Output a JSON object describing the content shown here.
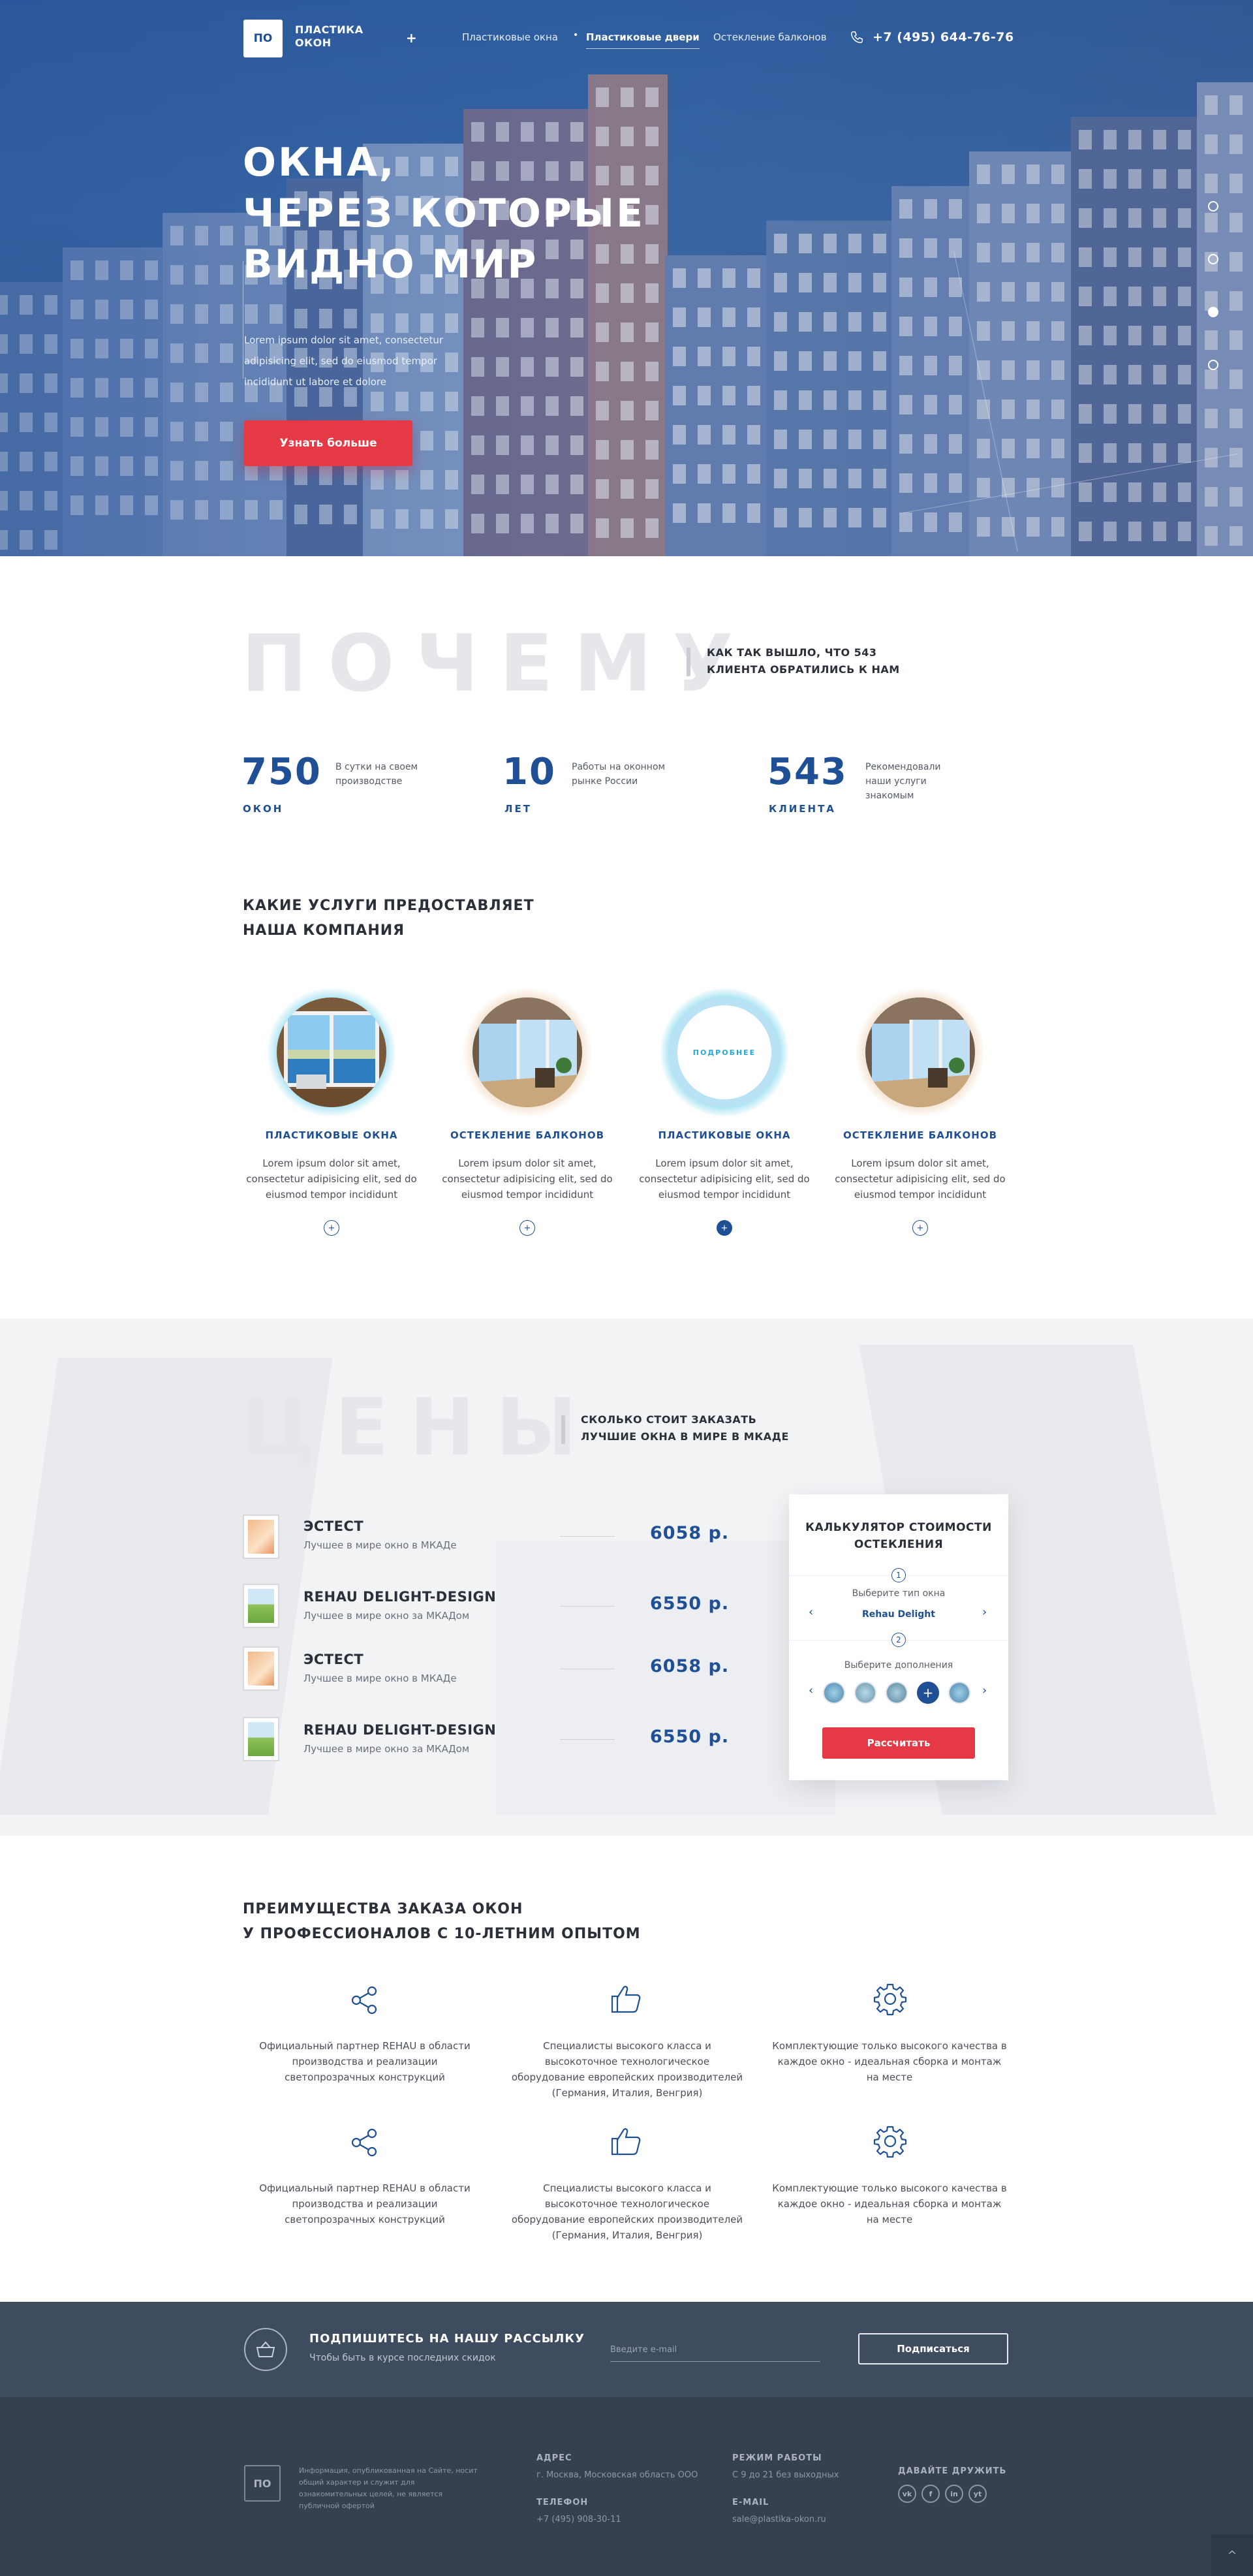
{
  "header": {
    "logo_mark": "ПО",
    "logo_text": "ПЛАСТИКА ОКОН",
    "nav": [
      "Пластиковые окна",
      "Пластиковые двери",
      "Остекление балконов"
    ],
    "active_nav": "Пластиковые двери",
    "phone": "+7 (495) 644-76-76"
  },
  "hero": {
    "title_lines": [
      "ОКНА,",
      "ЧЕРЕЗ КОТОРЫЕ",
      "ВИДНО МИР"
    ],
    "text": "Lorem ipsum dolor sit amet, consectetur adipisicing elit, sed do eiusmod tempor incididunt ut labore et dolore",
    "button": "Узнать больше",
    "slides_count": 4,
    "active_slide": 3
  },
  "why": {
    "big_word": "ПОЧЕМУ",
    "side_text": "КАК ТАК ВЫШЛО, ЧТО 543 КЛИЕНТА ОБРАТИЛИСЬ К НАМ",
    "stats": [
      {
        "num": "750",
        "unit": "ОКОН",
        "desc": "В сутки на своем производстве"
      },
      {
        "num": "10",
        "unit": "ЛЕТ",
        "desc": "Работы на оконном рынке России"
      },
      {
        "num": "543",
        "unit": "КЛИЕНТА",
        "desc": "Рекомендовали наши услуги знакомым"
      }
    ]
  },
  "services": {
    "heading_lines": [
      "КАКИЕ УСЛУГИ ПРЕДОСТАВЛЯЕТ",
      "НАША КОМПАНИЯ"
    ],
    "hover_label": "ПОДРОБНЕЕ",
    "items": [
      {
        "title": "ПЛАСТИКОВЫЕ ОКНА",
        "text": "Lorem ipsum dolor sit amet, consectetur adipisicing elit, sed do eiusmod tempor incididunt"
      },
      {
        "title": "ОСТЕКЛЕНИЕ БАЛКОНОВ",
        "text": "Lorem ipsum dolor sit amet, consectetur adipisicing elit, sed do eiusmod tempor incididunt"
      },
      {
        "title": "ПЛАСТИКОВЫЕ ОКНА",
        "text": "Lorem ipsum dolor sit amet, consectetur adipisicing elit, sed do eiusmod tempor incididunt"
      },
      {
        "title": "ОСТЕКЛЕНИЕ БАЛКОНОВ",
        "text": "Lorem ipsum dolor sit amet, consectetur adipisicing elit, sed do eiusmod tempor incididunt"
      }
    ],
    "more_symbol": "+"
  },
  "prices": {
    "big_word": "ЦЕНЫ",
    "side_text": "СКОЛЬКО СТОИТ ЗАКАЗАТЬ ЛУЧШИЕ ОКНА В МИРЕ В МКАДЕ",
    "items": [
      {
        "name": "ЭСТЕСТ",
        "sub": "Лучшее в мире окно в МКАДе",
        "price": "6058 р."
      },
      {
        "name": "REHAU DELIGHT-DESIGN",
        "sub": "Лучшее в мире окно за МКАДом",
        "price": "6550 р."
      },
      {
        "name": "ЭСТЕСТ",
        "sub": "Лучшее в мире окно в МКАДе",
        "price": "6058 р."
      },
      {
        "name": "REHAU DELIGHT-DESIGN",
        "sub": "Лучшее в мире окно за МКАДом",
        "price": "6550 р."
      }
    ]
  },
  "calculator": {
    "title": "КАЛЬКУЛЯТОР СТОИМОСТИ ОСТЕКЛЕНИЯ",
    "step1": "1",
    "step1_label": "Выберите тип окна",
    "step1_value": "Rehau Delight",
    "step2": "2",
    "step2_label": "Выберите дополнения",
    "prev": "‹",
    "next": "›",
    "plus": "+",
    "button": "Рассчитать"
  },
  "advantages": {
    "heading_lines": [
      "ПРЕИМУЩЕСТВА ЗАКАЗА ОКОН",
      "У ПРОФЕССИОНАЛОВ С 10-ЛЕТНИМ ОПЫТОМ"
    ],
    "items": [
      {
        "icon": "share-icon",
        "text": "Официальный партнер REHAU в области производства и реализации светопрозрачных конструкций"
      },
      {
        "icon": "thumbs-up-icon",
        "text": "Специалисты высокого класса и высокоточное технологическое оборудование европейских производителей (Германия, Италия, Венгрия)"
      },
      {
        "icon": "gear-icon",
        "text": "Комплектующие только высокого качества в каждое окно - идеальная сборка и монтаж на месте"
      },
      {
        "icon": "share-icon",
        "text": "Официальный партнер REHAU в области производства и реализации светопрозрачных конструкций"
      },
      {
        "icon": "thumbs-up-icon",
        "text": "Специалисты высокого класса и высокоточное технологическое оборудование европейских производителей (Германия, Италия, Венгрия)"
      },
      {
        "icon": "gear-icon",
        "text": "Комплектующие только высокого качества в каждое окно - идеальная сборка и монтаж на месте"
      }
    ]
  },
  "subscribe": {
    "title": "ПОДПИШИТЕСЬ НА НАШУ РАССЫЛКУ",
    "text": "Чтобы быть в курсе последних скидок",
    "placeholder": "Введите e-mail",
    "button": "Подписаться"
  },
  "footer": {
    "logo_mark": "ПО",
    "legal": "Информация, опубликованная на Сайте, носит общий характер и служит для ознакомительных целей, не является публичной офертой",
    "address_label": "АДРЕС",
    "address": "г. Москва, Московская область ООО",
    "phone_label": "ТЕЛЕФОН",
    "phone": "+7 (495) 908-30-11",
    "hours_label": "РЕЖИМ РАБОТЫ",
    "hours": "С 9 до 21 без выходных",
    "email_label": "E-MAIL",
    "email": "sale@plastika-okon.ru",
    "social_label": "ДАВАЙТЕ ДРУЖИТЬ",
    "social": [
      "vk",
      "f",
      "in",
      "yt"
    ],
    "to_top": "^"
  },
  "colors": {
    "accent": "#1f4f95",
    "cta": "#e63946",
    "dark": "#36404f"
  }
}
